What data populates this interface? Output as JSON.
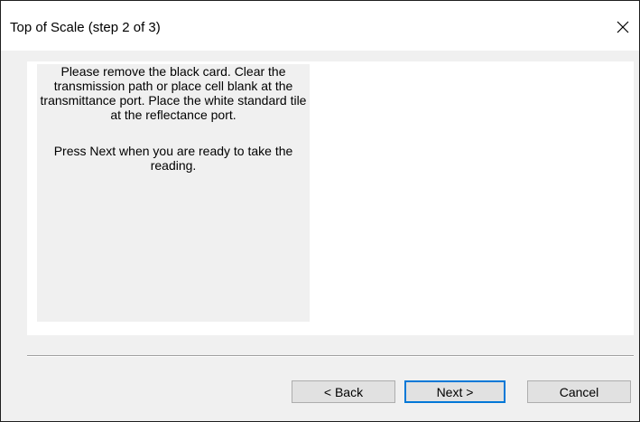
{
  "window": {
    "title": "Top of Scale (step 2 of 3)"
  },
  "instructions": {
    "line1": "Please remove the black card.  Clear the transmission path or place cell blank at the transmittance port.  Place the white standard tile at the reflectance port.",
    "line2": "Press Next when you are ready to take the reading."
  },
  "buttons": {
    "back_label": "< Back",
    "next_label": "Next >",
    "cancel_label": "Cancel"
  },
  "colors": {
    "dialog_background": "#f0f0f0",
    "panel_background": "#ffffff",
    "default_button_border": "#0078d7"
  }
}
